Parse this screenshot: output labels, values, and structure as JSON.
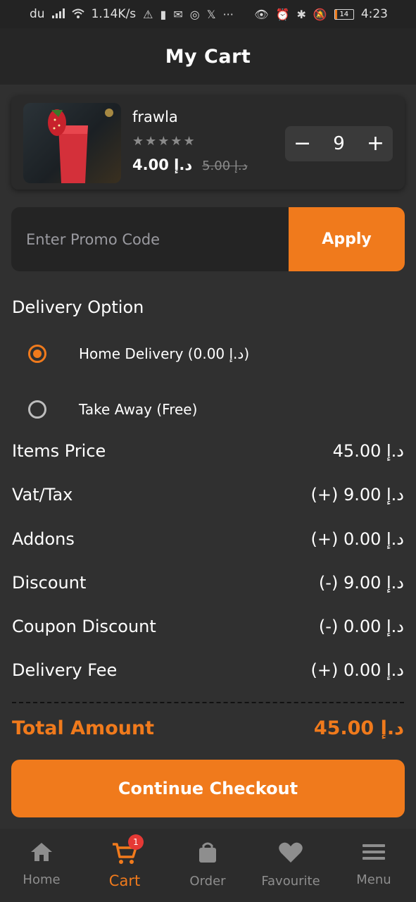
{
  "status_bar": {
    "carrier": "du",
    "speed": "1.14K/s",
    "battery": "14",
    "time": "4:23",
    "battery_fraction": 0.14
  },
  "header": {
    "title": "My Cart"
  },
  "cart_item": {
    "name": "frawla",
    "stars": "★★★★★",
    "price_now": "د.إ 4.00",
    "price_old": "د.إ 5.00",
    "quantity": "9",
    "minus": "−",
    "plus": "+"
  },
  "promo": {
    "placeholder": "Enter Promo Code",
    "apply_label": "Apply"
  },
  "delivery": {
    "title": "Delivery Option",
    "options": [
      {
        "label": "Home Delivery (د.إ 0.00)",
        "selected": true
      },
      {
        "label": "Take Away (Free)",
        "selected": false
      }
    ]
  },
  "summary": [
    {
      "label": "Items Price",
      "value": "د.إ 45.00"
    },
    {
      "label": "Vat/Tax",
      "value": "(+) د.إ 9.00"
    },
    {
      "label": "Addons",
      "value": "(+) د.إ 0.00"
    },
    {
      "label": "Discount",
      "value": "(-) د.إ 9.00"
    },
    {
      "label": "Coupon Discount",
      "value": "(-) د.إ 0.00"
    },
    {
      "label": "Delivery Fee",
      "value": "(+) د.إ 0.00"
    }
  ],
  "total": {
    "label": "Total Amount",
    "value": "د.إ 45.00"
  },
  "checkout_label": "Continue Checkout",
  "nav": {
    "cart_badge": "1",
    "items": [
      {
        "label": "Home"
      },
      {
        "label": "Cart"
      },
      {
        "label": "Order"
      },
      {
        "label": "Favourite"
      },
      {
        "label": "Menu"
      }
    ]
  },
  "colors": {
    "accent": "#f07a1c",
    "background": "#303030",
    "badge": "#e53935"
  }
}
